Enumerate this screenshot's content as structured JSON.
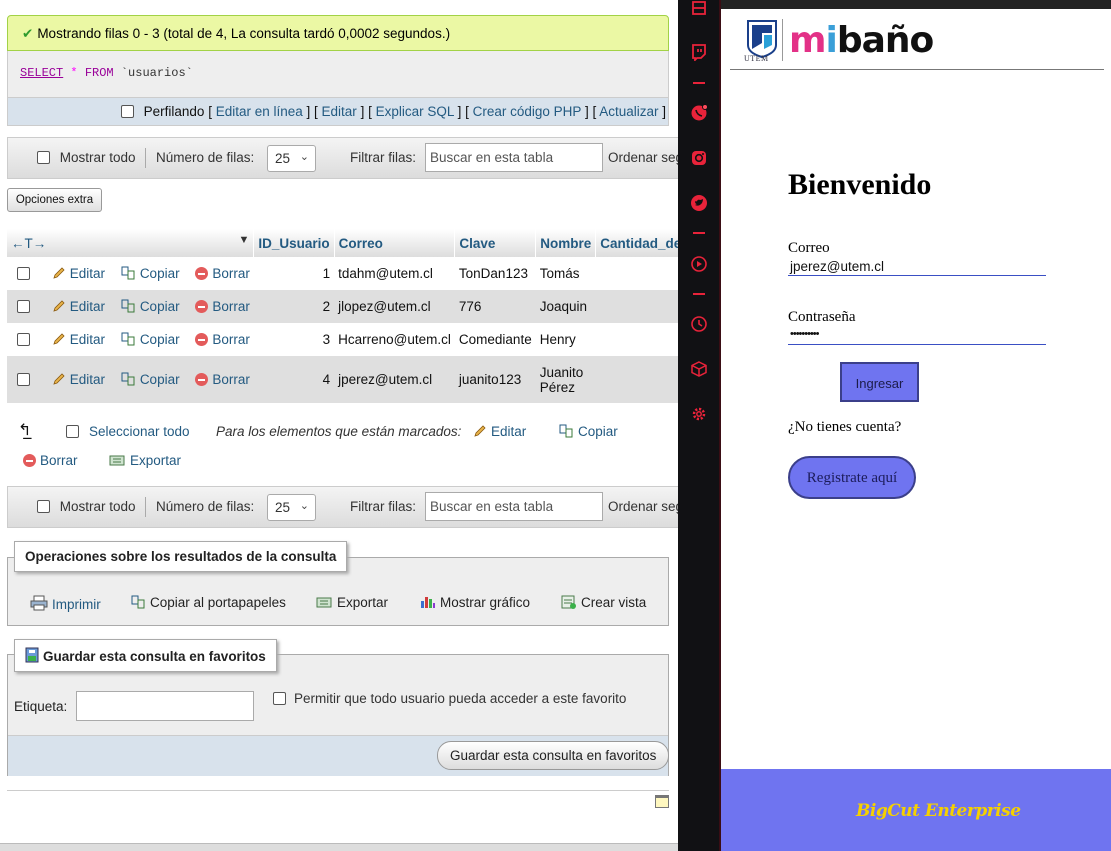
{
  "pma": {
    "success_msg": "Mostrando filas 0 - 3 (total de 4, La consulta tardó 0,0002 segundos.)",
    "sql": {
      "select": "SELECT",
      "star": "*",
      "from": "FROM",
      "table": "`usuarios`"
    },
    "links": {
      "profiling": "Perfilando",
      "edit_inline": "Editar en línea",
      "edit": "Editar",
      "explain": "Explicar SQL",
      "php": "Crear código PHP",
      "refresh": "Actualizar"
    },
    "nav": {
      "show_all": "Mostrar todo",
      "rows_label": "Número de filas:",
      "rows_value": "25",
      "filter_label": "Filtrar filas:",
      "filter_placeholder": "Buscar en esta tabla",
      "sort_label": "Ordenar seg"
    },
    "extra_options": "Opciones extra",
    "columns": [
      "ID_Usuario",
      "Correo",
      "Clave",
      "Nombre",
      "Cantidad_de"
    ],
    "row_actions": {
      "edit": "Editar",
      "copy": "Copiar",
      "delete": "Borrar"
    },
    "rows": [
      {
        "id": "1",
        "correo": "tdahm@utem.cl",
        "clave": "TonDan123",
        "nombre": "Tomás",
        "nombre2": ""
      },
      {
        "id": "2",
        "correo": "jlopez@utem.cl",
        "clave": "776",
        "nombre": "Joaquin",
        "nombre2": ""
      },
      {
        "id": "3",
        "correo": "Hcarreno@utem.cl",
        "clave": "Comediante",
        "nombre": "Henry",
        "nombre2": ""
      },
      {
        "id": "4",
        "correo": "jperez@utem.cl",
        "clave": "juanito123",
        "nombre": "Juanito",
        "nombre2": "Pérez"
      }
    ],
    "bulk": {
      "select_all": "Seleccionar todo",
      "marked": "Para los elementos que están marcados:",
      "edit": "Editar",
      "copy": "Copiar",
      "delete": "Borrar",
      "export": "Exportar"
    },
    "ops": {
      "title": "Operaciones sobre los resultados de la consulta",
      "print": "Imprimir",
      "copy_clip": "Copiar al portapapeles",
      "export": "Exportar",
      "chart": "Mostrar gráfico",
      "view": "Crear vista"
    },
    "fav": {
      "title": "Guardar esta consulta en favoritos",
      "label": "Etiqueta:",
      "allow": "Permitir que todo usuario pueda acceder a este favorito",
      "save_btn": "Guardar esta consulta en favoritos"
    }
  },
  "dock": {
    "icons": [
      "gift-icon",
      "twitch-icon",
      "whatsapp-icon",
      "instagram-icon",
      "twitter-icon",
      "play-icon",
      "clock-icon",
      "box-icon",
      "settings-icon"
    ]
  },
  "app": {
    "brand": {
      "m": "m",
      "i": "i",
      "rest": "baño"
    },
    "utem": "UTEM",
    "welcome": "Bienvenido",
    "email_label": "Correo",
    "email_value": "jperez@utem.cl",
    "pass_label": "Contraseña",
    "pass_value": "••••••••••",
    "submit": "Ingresar",
    "no_account": "¿No tienes cuenta?",
    "register": "Registrate aquí",
    "footer": "BigCut Enterprise",
    "colors": {
      "button": "#6f74f0",
      "footer_text": "#f5d000"
    }
  }
}
